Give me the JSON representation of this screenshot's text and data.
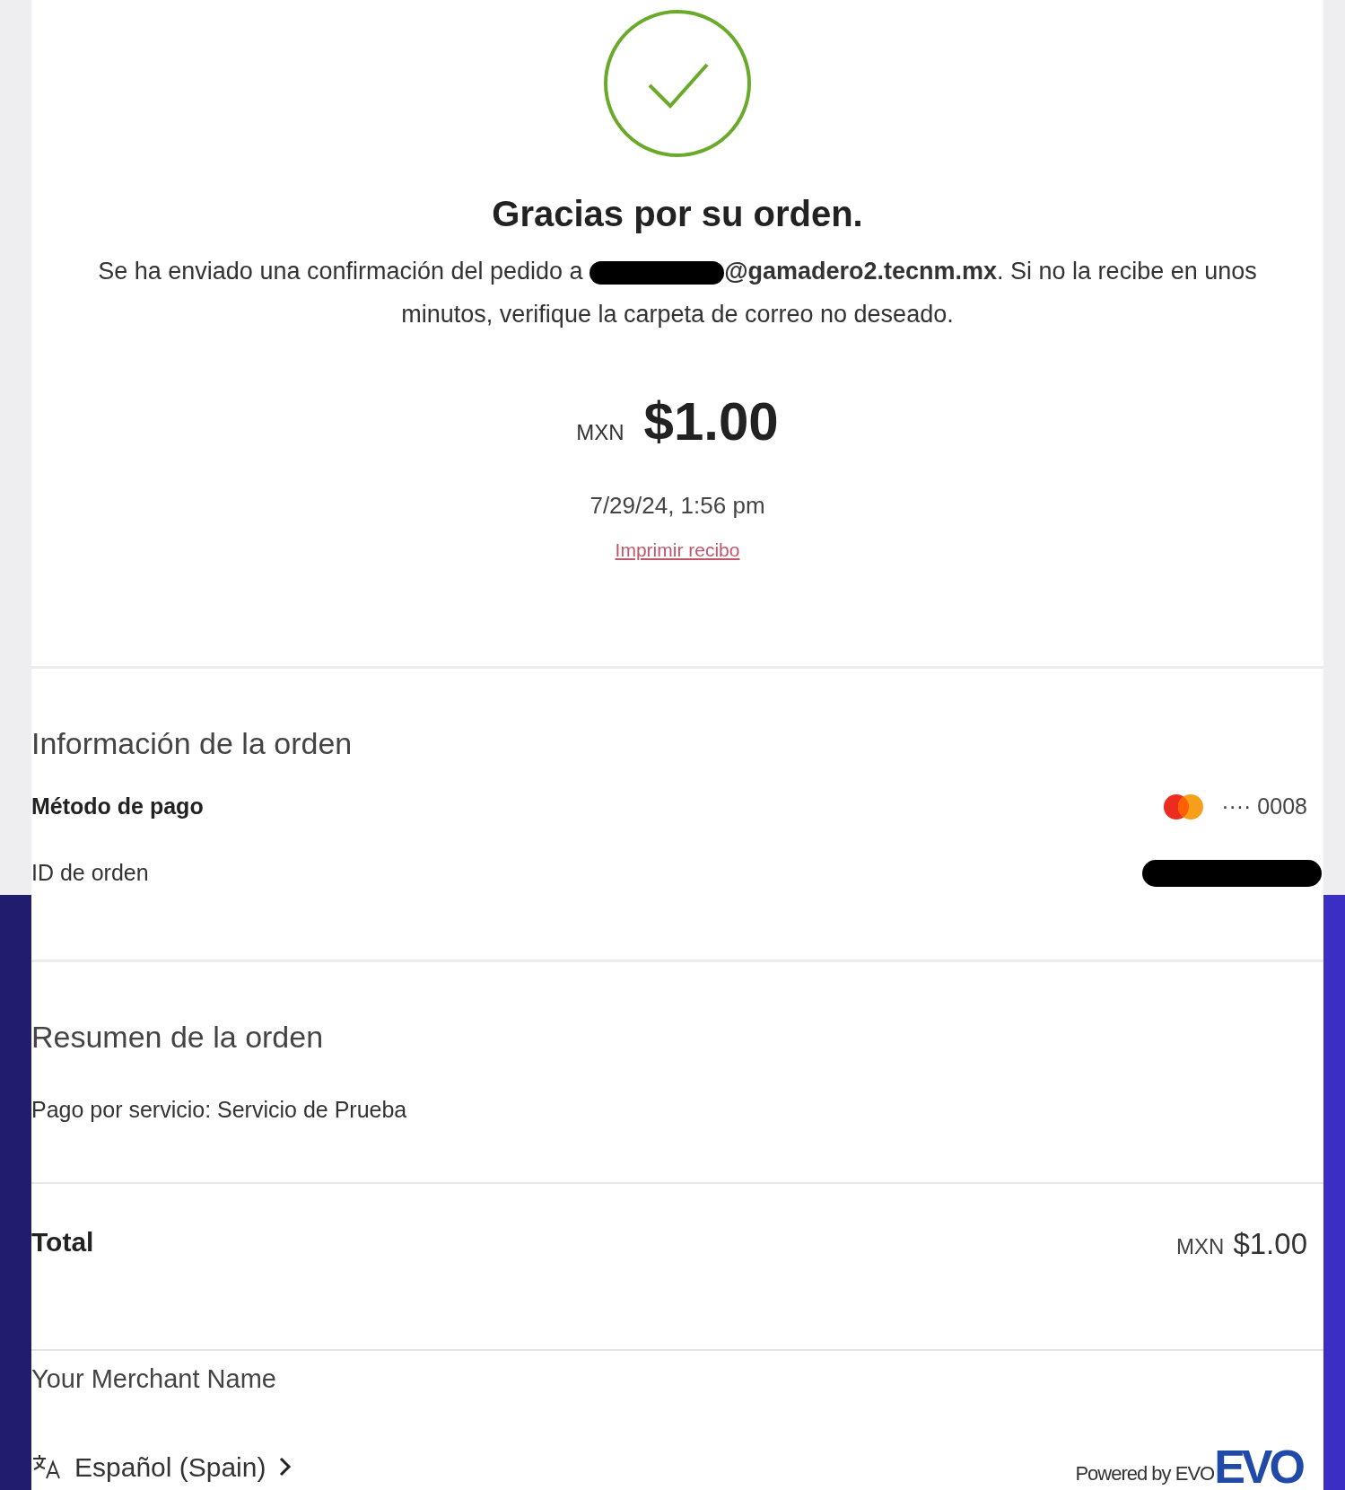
{
  "confirmation": {
    "title": "Gracias por su orden.",
    "message_before": "Se ha enviado una confirmación del pedido a",
    "email_visible": "@gamadero2.tecnm.mx",
    "message_after": ". Si no la recibe en unos minutos, verifique la carpeta de correo no deseado.",
    "currency": "MXN",
    "amount": "$1.00",
    "date": "7/29/24, 1:56 pm",
    "print_link": "Imprimir recibo"
  },
  "order_info": {
    "heading": "Información de la orden",
    "rows": [
      {
        "kind": "card",
        "label": "Método de pago",
        "value": "···· 0008"
      },
      {
        "kind": "redacted",
        "label": "ID de orden"
      }
    ]
  },
  "order_summary": {
    "heading": "Resumen de la orden",
    "item": "Pago por servicio: Servicio de Prueba",
    "total_label": "Total",
    "total_currency": "MXN",
    "total_amount": "$1.00"
  },
  "merchant": "Your Merchant Name",
  "footer": {
    "language": "Español (Spain)",
    "powered_by": "Powered by EVO",
    "logo_text": "EVO"
  }
}
